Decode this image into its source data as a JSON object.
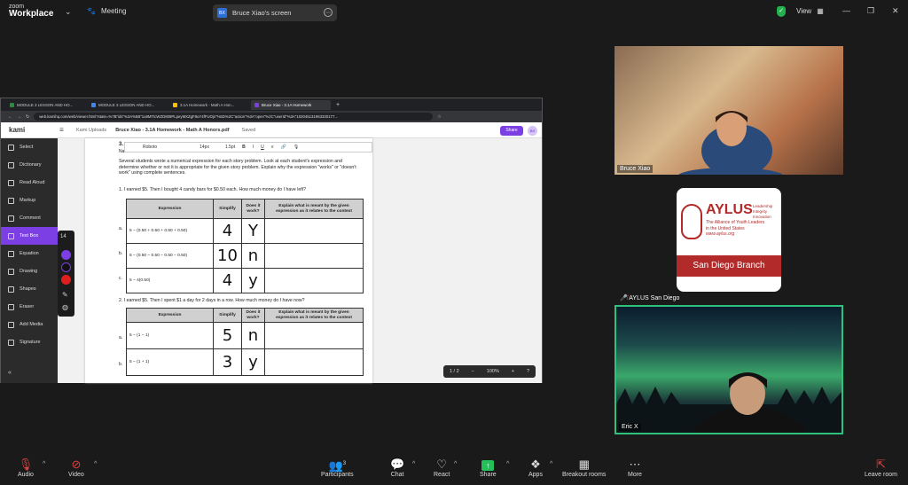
{
  "app": {
    "brand_small": "zoom",
    "brand_name": "Workplace",
    "meeting_label": "Meeting",
    "screen_pill": "Bruce Xiao's screen",
    "screen_pill_initials": "BX",
    "view_label": "View"
  },
  "browser": {
    "tabs": [
      "MODULE 3 LESSON AND HO...",
      "MODULE 3 LESSON AND HO...",
      "3.1A Homework - Math A Hon...",
      "Bruce Xiao - 3.1A Homework"
    ],
    "url": "web.kamihq.com/web/viewer.html?state=%7B\"ids\"%3A%5B\"1u9MTtcWZD809PLpeyMXZgF8uY4fFUOjs\"%5D%2C\"action\"%3A\"open\"%2C\"userId\"%3A\"102045131963330177..."
  },
  "kami": {
    "logo": "kami",
    "breadcrumb_folder": "Kami Uploads",
    "doc_title": "Bruce Xiao - 3.1A Homework - Math A Honors.pdf",
    "saved": "Saved",
    "share": "Share",
    "user_initials": "BX",
    "tools": [
      "Select",
      "Dictionary",
      "Read Aloud",
      "Markup",
      "Comment",
      "Text Box",
      "Equation",
      "Drawing",
      "Shapes",
      "Eraser",
      "Add Media",
      "Signature"
    ],
    "active_tool": "Text Box",
    "font_name": "Roboto",
    "font_size": "14px",
    "line_spacing": "1.5pt",
    "palette_size": "14",
    "pager": {
      "page": "1 / 2",
      "zoom": "100%"
    }
  },
  "doc": {
    "header_num": "3.",
    "header_name": "Na",
    "intro": "Several students wrote a numerical expression for each story problem. Look at each student's expression and determine whether or not it is appropriate for the given story problem. Explain why the expression \"works\" or \"doesn't work\" using complete sentences.",
    "q1": "1.   I earned $5.  Then I bought 4 candy bars for $0.50 each. How much money do I have left?",
    "q2": "2.   I earned $5.  Then I spent $1 a day for 2 days in a row.  How much money do I have now?",
    "headers": {
      "expression": "Expression",
      "simplify": "Simplify",
      "works": "Does it work?",
      "explain": "Explain what is meant by the given expression as it relates to the context"
    },
    "t1_rows": [
      {
        "lbl": "a.",
        "expr": "5 − (0.50 + 0.50 + 0.50 + 0.50)",
        "simplify": "4",
        "works": "Y"
      },
      {
        "lbl": "b.",
        "expr": "5 − (0.50 − 0.50 − 0.50 − 0.50)",
        "simplify": "10",
        "works": "n"
      },
      {
        "lbl": "c.",
        "expr": "5 − 4(0.50)",
        "simplify": "4",
        "works": "y"
      }
    ],
    "t2_rows": [
      {
        "lbl": "a.",
        "expr": "5 − (1 − 1)",
        "simplify": "5",
        "works": "n"
      },
      {
        "lbl": "b.",
        "expr": "5 − (1 + 1)",
        "simplify": "3",
        "works": "y"
      }
    ]
  },
  "participants_tiles": [
    {
      "name": "Bruce Xiao"
    },
    {
      "name": "AYLUS San Diego",
      "logo_title": "AYLUS",
      "logo_tag1": "Leadership",
      "logo_tag2": "Integrity",
      "logo_tag3": "Innovation",
      "logo_line1": "The Alliance of Youth Leaders",
      "logo_line2": "in the United States",
      "logo_url": "www.aylus.org",
      "branch": "San Diego Branch"
    },
    {
      "name": "Eric X"
    }
  ],
  "bottombar": {
    "audio": "Audio",
    "video": "Video",
    "participants": "Participants",
    "participants_count": "3",
    "chat": "Chat",
    "react": "React",
    "share": "Share",
    "apps": "Apps",
    "breakout": "Breakout rooms",
    "more": "More",
    "leave": "Leave room"
  },
  "colors": {
    "kami_purple": "#7b3fe4",
    "zoom_green": "#22b14c",
    "share_green": "#23c05a",
    "active_speaker": "#2ec27e"
  }
}
